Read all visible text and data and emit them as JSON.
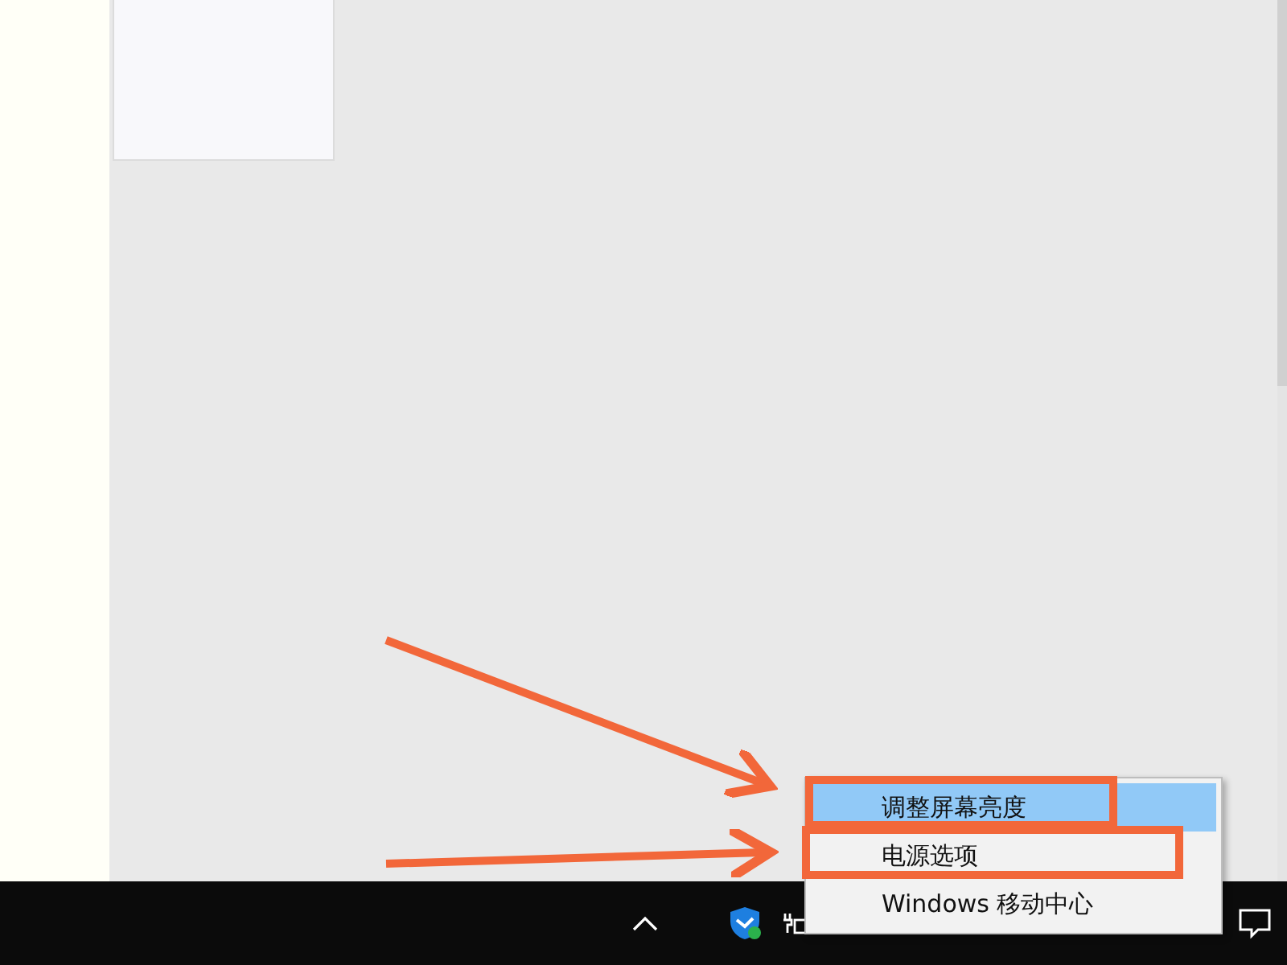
{
  "context_menu": {
    "items": [
      {
        "label": "调整屏幕亮度",
        "selected": true
      },
      {
        "label": "电源选项",
        "selected": false
      },
      {
        "label": "Windows 移动中心",
        "selected": false
      }
    ]
  }
}
